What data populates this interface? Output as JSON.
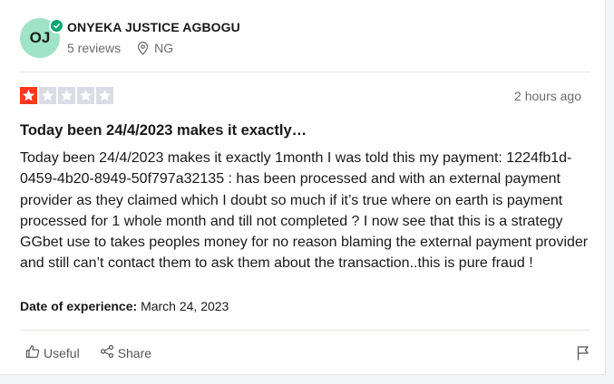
{
  "reviewer": {
    "initials": "OJ",
    "name": "ONYEKA JUSTICE AGBOGU",
    "reviews_count": "5 reviews",
    "country": "NG"
  },
  "review": {
    "rating": 1,
    "max_rating": 5,
    "time_ago": "2 hours ago",
    "title": "Today been 24/4/2023 makes it exactly…",
    "body": "Today been 24/4/2023 makes it exactly 1month I was told this my payment: 1224fb1d-0459-4b20-8949-50f797a32135 : has been processed and with an external payment provider as they claimed which I doubt so much if it’s true where on earth is payment processed for 1 whole month and till not completed ? I now see that this is a strategy GGbet use to takes peoples money for no reason blaming the external payment provider and still can’t contact them to ask them about the transaction..this is pure fraud !",
    "experience_label": "Date of experience:",
    "experience_date": "March 24, 2023"
  },
  "actions": {
    "useful_label": "Useful",
    "share_label": "Share"
  },
  "colors": {
    "star_filled": "#ff3722",
    "star_empty": "#dcdce6",
    "avatar_bg": "#9fe3c8",
    "verified": "#04a46d"
  }
}
